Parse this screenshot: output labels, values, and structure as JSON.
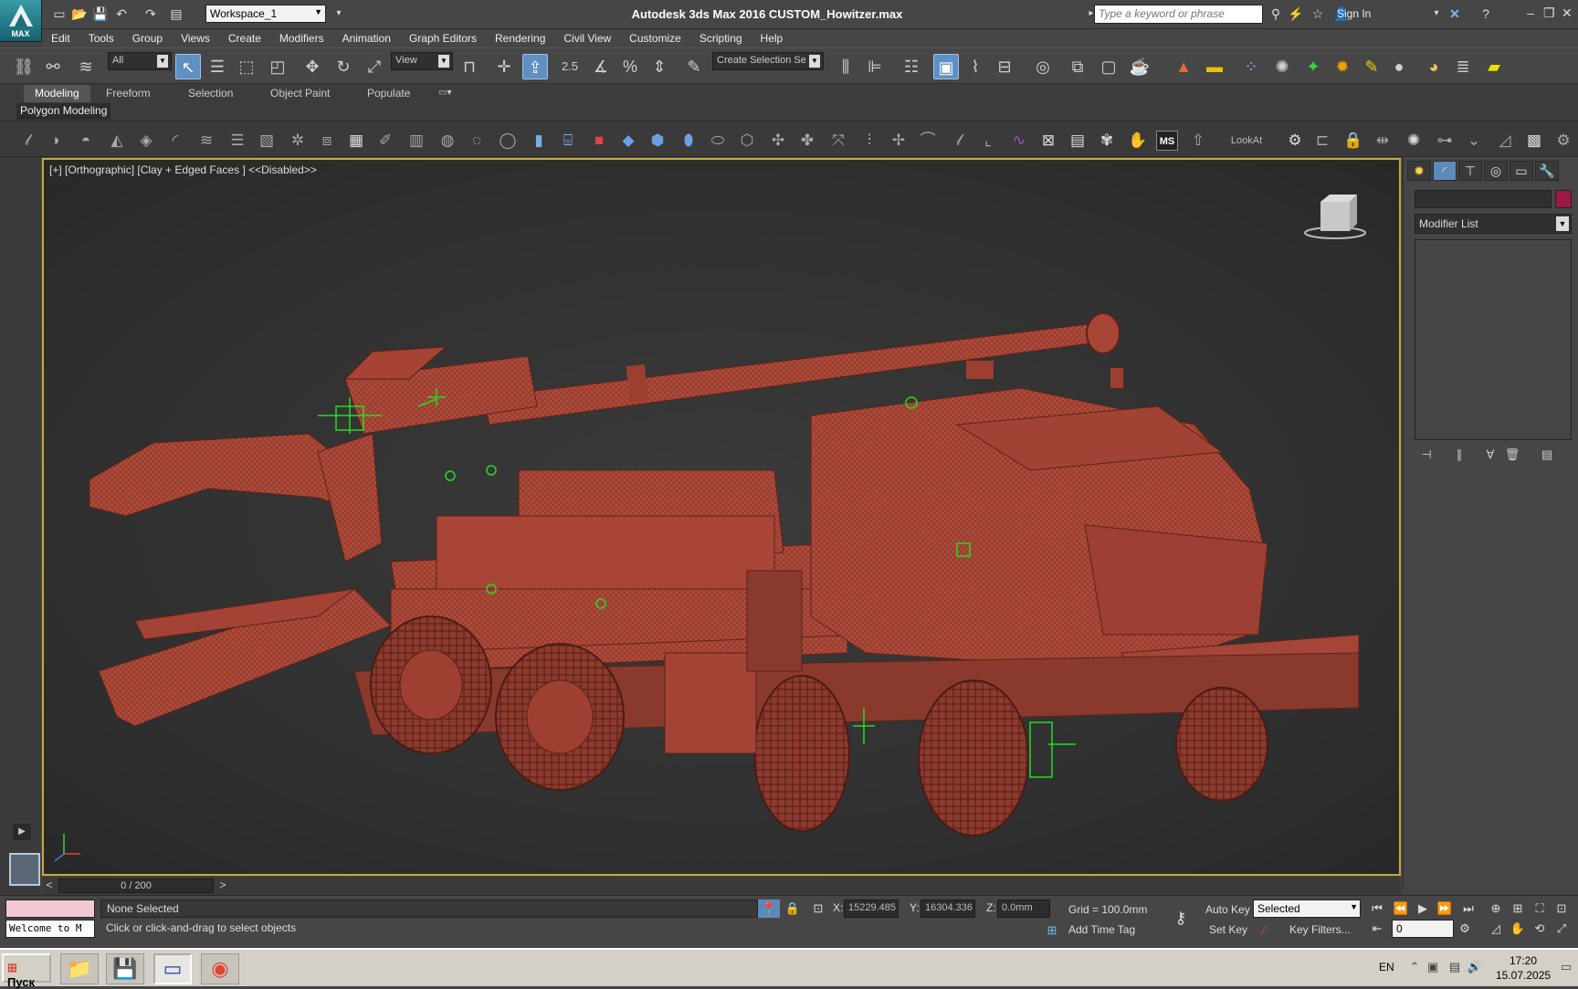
{
  "titlebar": {
    "app_title": "Autodesk 3ds Max 2016      CUSTOM_Howitzer.max",
    "workspace": "Workspace_1",
    "search_placeholder": "Type a keyword or phrase",
    "sign_in": "Sign In",
    "logo_text": "MAX"
  },
  "menu": [
    "Edit",
    "Tools",
    "Group",
    "Views",
    "Create",
    "Modifiers",
    "Animation",
    "Graph Editors",
    "Rendering",
    "Civil View",
    "Customize",
    "Scripting",
    "Help"
  ],
  "toolbar": {
    "selection_filter": "All",
    "reference_coord": "View",
    "named_selection": "Create Selection Se",
    "snap_label": "2.5"
  },
  "ribbon": {
    "tabs": [
      "Modeling",
      "Freeform",
      "Selection",
      "Object Paint",
      "Populate"
    ],
    "active_tab": "Modeling",
    "panel_label": "Polygon Modeling"
  },
  "shelf": {
    "lookat_label": "LookAt"
  },
  "viewport": {
    "label": "[+] [Orthographic] [Clay + Edged Faces ]  <<Disabled>>",
    "model_color": "#b04a3a",
    "wire_color": "#6a2a20",
    "helper_color": "#22dd22"
  },
  "command_panel": {
    "modifier_list": "Modifier List",
    "object_color": "#9c1845"
  },
  "timeline": {
    "frame_display": "0 / 200"
  },
  "status": {
    "selection": "None Selected",
    "prompt": "Click or click-and-drag to select objects",
    "maxscript": "Welcome to M",
    "x_label": "X:",
    "x_value": "15229.485",
    "y_label": "Y:",
    "y_value": "16304.336",
    "z_label": "Z:",
    "z_value": "0.0mm",
    "grid": "Grid = 100.0mm",
    "add_time_tag": "Add Time Tag",
    "auto_key": "Auto Key",
    "set_key": "Set Key",
    "key_mode": "Selected",
    "key_filters": "Key Filters...",
    "current_frame": "0"
  },
  "taskbar": {
    "start": "Пуск",
    "lang": "EN",
    "time": "17:20",
    "date": "15.07.2025"
  }
}
